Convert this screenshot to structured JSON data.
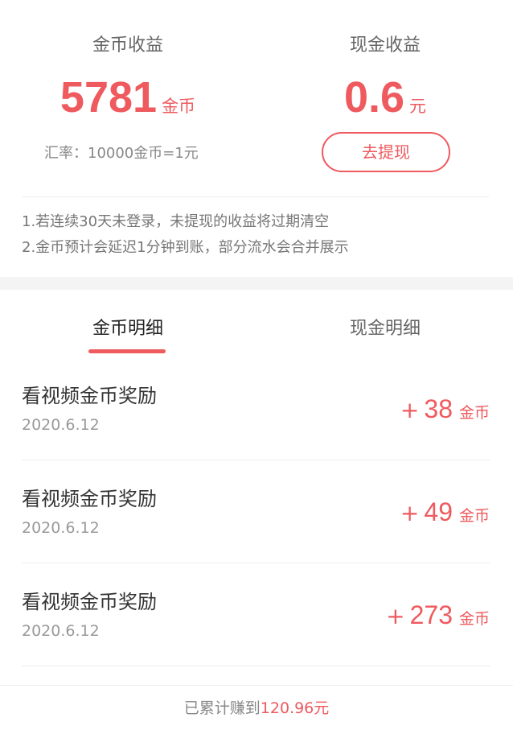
{
  "summary": {
    "coin": {
      "title": "金币收益",
      "amount": "5781",
      "unit": "金币"
    },
    "cash": {
      "title": "现金收益",
      "amount": "0.6",
      "unit": "元"
    },
    "rate_text": "汇率：10000金币=1元",
    "withdraw_label": "去提现",
    "notes": [
      "1.若连续30天未登录，未提现的收益将过期清空",
      "2.金币预计会延迟1分钟到账，部分流水会合并展示"
    ]
  },
  "tabs": [
    {
      "label": "金币明细",
      "active": true
    },
    {
      "label": "现金明细",
      "active": false
    }
  ],
  "records": [
    {
      "title": "看视频金币奖励",
      "date": "2020.6.12",
      "sign": "+",
      "amount": "38",
      "unit": "金币"
    },
    {
      "title": "看视频金币奖励",
      "date": "2020.6.12",
      "sign": "+",
      "amount": "49",
      "unit": "金币"
    },
    {
      "title": "看视频金币奖励",
      "date": "2020.6.12",
      "sign": "+",
      "amount": "273",
      "unit": "金币"
    }
  ],
  "footer": {
    "prefix": "已累计赚到",
    "amount": "120.96元"
  },
  "colors": {
    "accent": "#ee5a5e",
    "band": "#f4f4f4"
  }
}
